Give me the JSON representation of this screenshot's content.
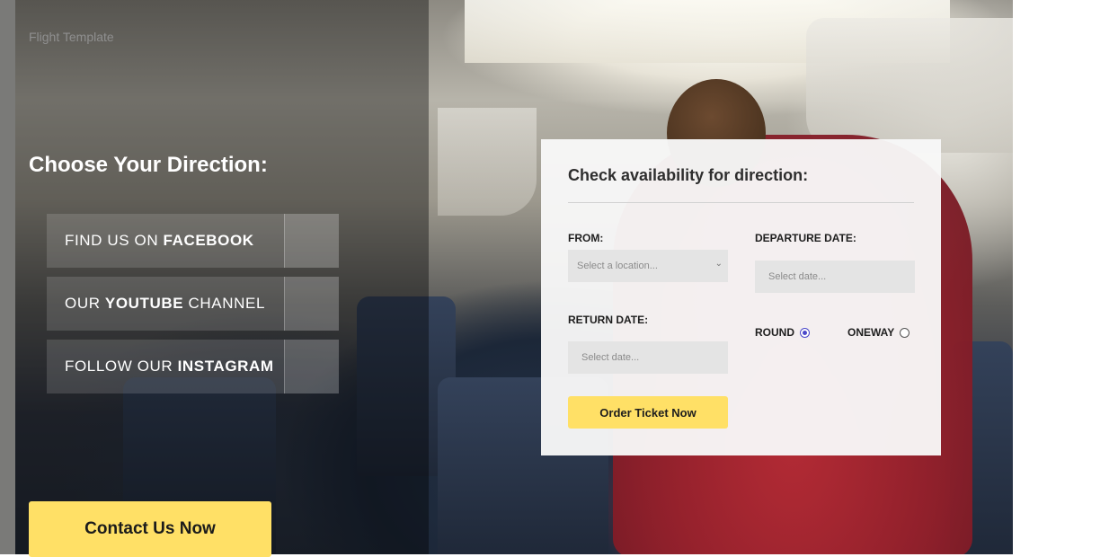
{
  "site": {
    "title": "Flight Template"
  },
  "directions": {
    "heading": "Choose Your Direction:",
    "links": [
      {
        "prefix": "FIND US ON ",
        "bold": "FACEBOOK",
        "suffix": ""
      },
      {
        "prefix": "OUR ",
        "bold": "YOUTUBE",
        "suffix": " CHANNEL"
      },
      {
        "prefix": "FOLLOW OUR ",
        "bold": "INSTAGRAM",
        "suffix": ""
      }
    ],
    "contact_label": "Contact Us Now"
  },
  "form": {
    "title": "Check availability for direction:",
    "from_label": "FROM:",
    "from_value": "Select a location...",
    "departure_label": "DEPARTURE DATE:",
    "departure_placeholder": "Select date...",
    "return_label": "RETURN DATE:",
    "return_placeholder": "Select date...",
    "trip_types": [
      {
        "label": "ROUND",
        "selected": true
      },
      {
        "label": "ONEWAY",
        "selected": false
      }
    ],
    "submit_label": "Order Ticket Now"
  },
  "colors": {
    "accent": "#ffe066",
    "radio_selected": "#4a48c9"
  },
  "icons": {
    "select": "chevron-down-icon"
  }
}
